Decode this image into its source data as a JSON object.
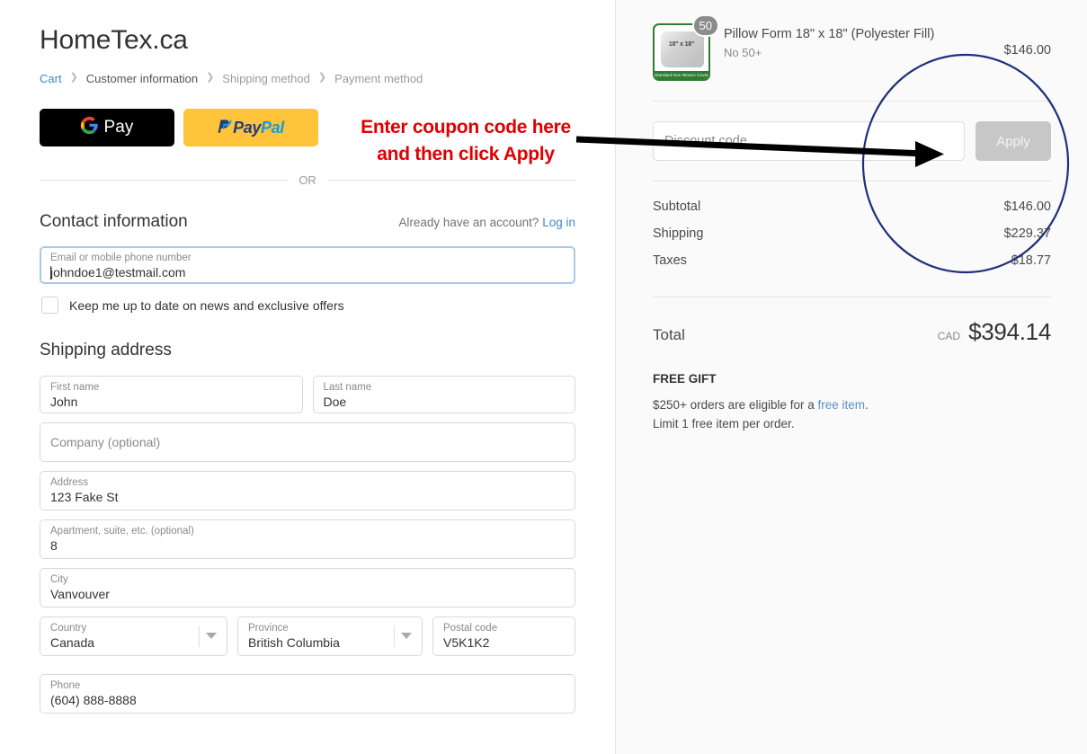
{
  "store": {
    "name": "HomeTex.ca"
  },
  "breadcrumb": {
    "items": [
      {
        "label": "Cart",
        "state": "link"
      },
      {
        "label": "Customer information",
        "state": "current"
      },
      {
        "label": "Shipping method",
        "state": "upcoming"
      },
      {
        "label": "Payment method",
        "state": "upcoming"
      }
    ],
    "separator": "❯"
  },
  "wallets": {
    "gpay_label": "Pay",
    "paypal_pay": "Pay",
    "paypal_pal": "Pal",
    "divider_label": "OR"
  },
  "contact": {
    "title": "Contact information",
    "account_prompt": "Already have an account?",
    "login_label": "Log in",
    "email": {
      "label": "Email or mobile phone number",
      "value": "johndoe1@testmail.com"
    },
    "newsletter_label": "Keep me up to date on news and exclusive offers",
    "newsletter_checked": false
  },
  "shipping_address": {
    "title": "Shipping address",
    "first_name": {
      "label": "First name",
      "value": "John"
    },
    "last_name": {
      "label": "Last name",
      "value": "Doe"
    },
    "company": {
      "label": "Company (optional)",
      "value": ""
    },
    "address": {
      "label": "Address",
      "value": "123 Fake St"
    },
    "apartment": {
      "label": "Apartment, suite, etc. (optional)",
      "value": "8"
    },
    "city": {
      "label": "City",
      "value": "Vanvouver"
    },
    "country": {
      "label": "Country",
      "value": "Canada"
    },
    "province": {
      "label": "Province",
      "value": "British Columbia"
    },
    "postal_code": {
      "label": "Postal code",
      "value": "V5K1K2"
    },
    "phone": {
      "label": "Phone",
      "value": "(604) 888-8888"
    }
  },
  "order_summary": {
    "line_item": {
      "title": "Pillow Form 18\" x 18\" (Polyester Fill)",
      "variant": "No 50+",
      "quantity": "50",
      "price": "$146.00",
      "thumb_size_text": "18\" x 18\"",
      "thumb_bar_text": "Standard Non Woven Cover"
    },
    "discount": {
      "placeholder": "Discount code",
      "value": "",
      "apply_label": "Apply"
    },
    "totals": [
      {
        "label": "Subtotal",
        "value": "$146.00"
      },
      {
        "label": "Shipping",
        "value": "$229.37"
      },
      {
        "label": "Taxes",
        "value": "$18.77"
      }
    ],
    "grand_total": {
      "label": "Total",
      "currency": "CAD",
      "amount": "$394.14"
    },
    "free_gift": {
      "title": "FREE GIFT",
      "line1_before": "$250+ orders are eligible for a ",
      "line1_link": "free item",
      "line1_after": ".",
      "line2": "Limit 1 free item per order."
    }
  },
  "annotation": {
    "line1": "Enter coupon code here",
    "line2": "and then click Apply",
    "text_color": "#e00000",
    "arrow_color": "#000000",
    "circle_color": "#1f2f7a"
  }
}
